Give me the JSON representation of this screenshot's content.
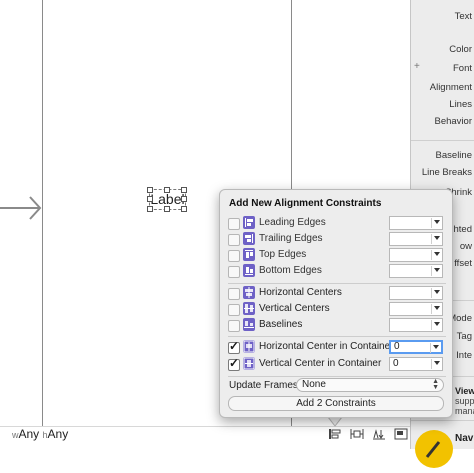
{
  "canvas": {
    "label_text": "Label",
    "size_class": {
      "w_prefix": "w",
      "w_value": "Any",
      "h_prefix": "h",
      "h_value": "Any"
    }
  },
  "inspector": {
    "labels": [
      "Text",
      "Color",
      "Font",
      "Alignment",
      "Lines",
      "Behavior",
      "Baseline",
      "Line Breaks",
      "Shrink",
      "hted",
      "ow",
      "ffset",
      "Mode",
      "Tag",
      "Inte"
    ],
    "library_item": {
      "title": "View",
      "desc1": "supp",
      "desc2": "mana"
    },
    "library_item2": {
      "title": "Navi"
    }
  },
  "popover": {
    "title": "Add New Alignment Constraints",
    "rows": [
      {
        "label": "Leading Edges",
        "checked": false,
        "value": ""
      },
      {
        "label": "Trailing Edges",
        "checked": false,
        "value": ""
      },
      {
        "label": "Top Edges",
        "checked": false,
        "value": ""
      },
      {
        "label": "Bottom Edges",
        "checked": false,
        "value": ""
      },
      {
        "label": "Horizontal Centers",
        "checked": false,
        "value": ""
      },
      {
        "label": "Vertical Centers",
        "checked": false,
        "value": ""
      },
      {
        "label": "Baselines",
        "checked": false,
        "value": ""
      },
      {
        "label": "Horizontal Center in Container",
        "checked": true,
        "value": "0"
      },
      {
        "label": "Vertical Center in Container",
        "checked": true,
        "value": "0"
      }
    ],
    "update_frames_label": "Update Frames",
    "update_frames_value": "None",
    "add_button": "Add 2 Constraints"
  },
  "colors": {
    "constraint_icon": "#6e61c6",
    "focus_ring": "#5a9bf0",
    "library_icon": "#f2c200"
  }
}
